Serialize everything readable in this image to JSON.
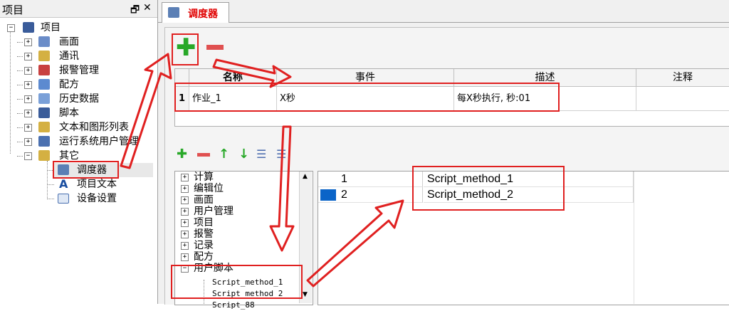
{
  "left_pane": {
    "title": "项目",
    "pin_glyph": "🗗",
    "close_glyph": "✕",
    "root": "项目",
    "items": [
      {
        "label": "画面",
        "icon": "screen-folder-icon"
      },
      {
        "label": "通讯",
        "icon": "comm-folder-icon"
      },
      {
        "label": "报警管理",
        "icon": "alarm-folder-icon"
      },
      {
        "label": "配方",
        "icon": "recipe-folder-icon"
      },
      {
        "label": "历史数据",
        "icon": "history-folder-icon"
      },
      {
        "label": "脚本",
        "icon": "script-folder-icon"
      },
      {
        "label": "文本和图形列表",
        "icon": "textlist-folder-icon"
      },
      {
        "label": "运行系统用户管理",
        "icon": "runtime-user-icon"
      },
      {
        "label": "其它",
        "icon": "other-folder-icon"
      }
    ],
    "children": [
      {
        "label": "调度器",
        "icon": "scheduler-icon"
      },
      {
        "label": "项目文本",
        "icon": "project-text-icon"
      },
      {
        "label": "设备设置",
        "icon": "device-settings-icon"
      }
    ]
  },
  "tab": {
    "label": "调度器"
  },
  "grid": {
    "headers": [
      "名称",
      "事件",
      "描述",
      "注释"
    ],
    "rows": [
      {
        "num": "1",
        "name": "作业_1",
        "event": "X秒",
        "desc": "每X秒执行, 秒:01",
        "note": ""
      }
    ]
  },
  "lower_tree": {
    "items": [
      "计算",
      "编辑位",
      "画面",
      "用户管理",
      "项目",
      "报警",
      "记录",
      "配方",
      "用户脚本"
    ],
    "scripts": [
      "Script_method_1",
      "Script_method_2",
      "Script_88"
    ]
  },
  "right_list": {
    "rows": [
      {
        "num": "1",
        "name": "Script_method_1"
      },
      {
        "num": "2",
        "name": "Script_method_2"
      }
    ]
  },
  "colors": {
    "accent_red": "#e02020",
    "add_green": "#28a828",
    "tab_text": "#e00000",
    "selection_blue": "#0a64c8"
  }
}
